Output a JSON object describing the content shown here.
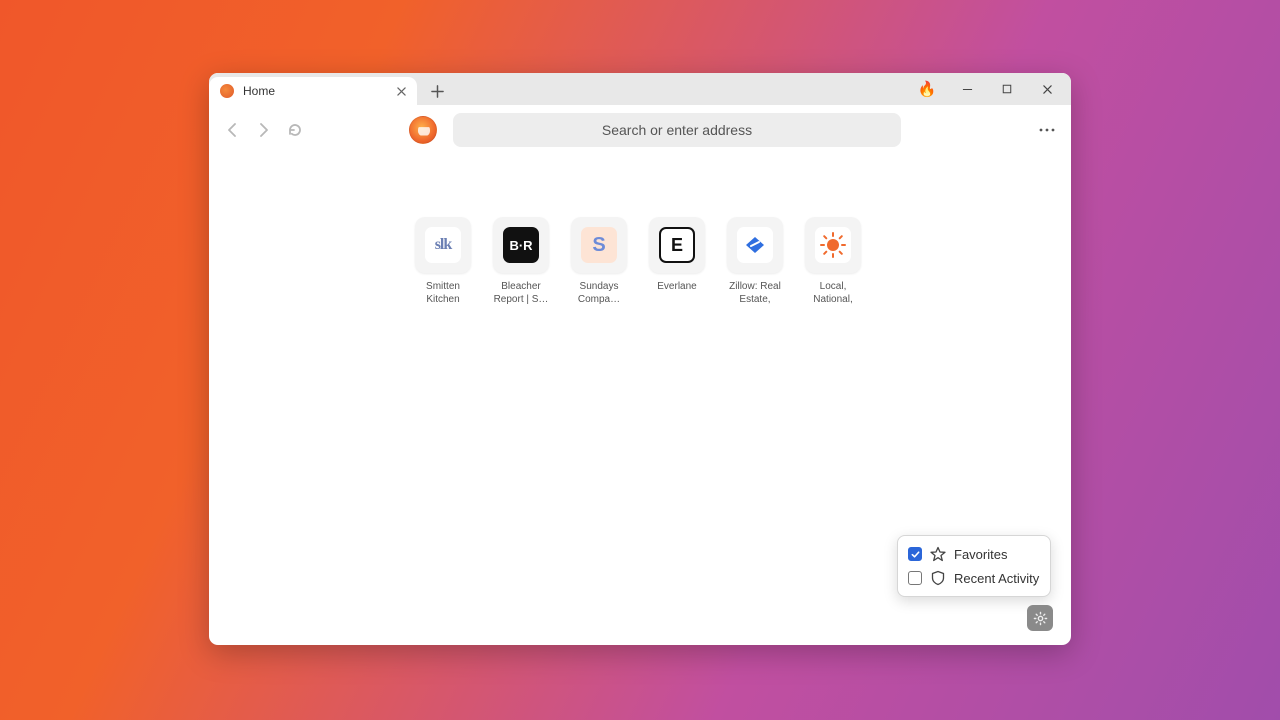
{
  "tab": {
    "title": "Home"
  },
  "addressbar": {
    "placeholder": "Search or enter address"
  },
  "tiles": [
    {
      "label": "Smitten Kitchen",
      "icon": "sk"
    },
    {
      "label": "Bleacher Report | S…",
      "icon": "br"
    },
    {
      "label": "Sundays Compa…",
      "icon": "s"
    },
    {
      "label": "Everlane",
      "icon": "e"
    },
    {
      "label": "Zillow: Real Estate, Apa…",
      "icon": "z"
    },
    {
      "label": "Local, National, &…",
      "icon": "ac"
    }
  ],
  "popup": {
    "favorites": {
      "label": "Favorites",
      "checked": true
    },
    "recent": {
      "label": "Recent Activity",
      "checked": false
    }
  }
}
